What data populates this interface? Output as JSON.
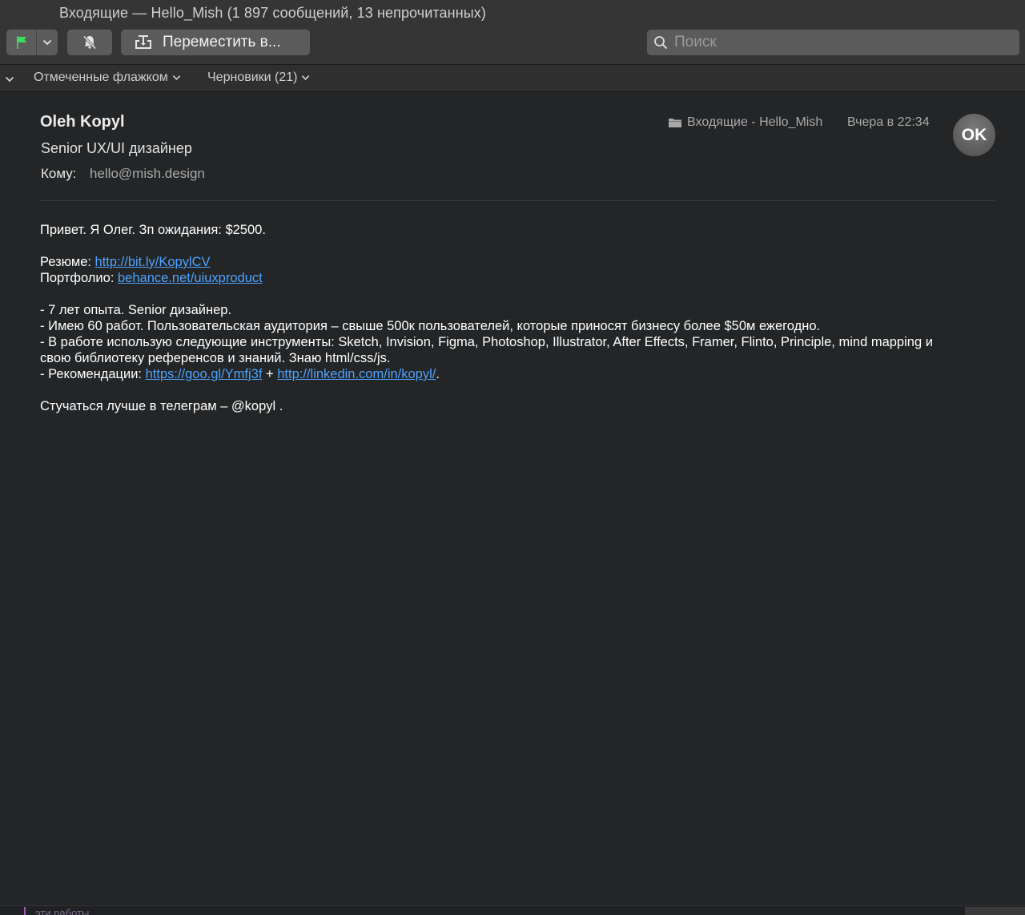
{
  "window": {
    "title": "Входящие — Hello_Mish (1 897 сообщений, 13 непрочитанных)"
  },
  "toolbar": {
    "move_label": "Переместить в...",
    "search_placeholder": "Поиск"
  },
  "favorites": {
    "flagged_label": "Отмеченные флажком",
    "drafts_label": "Черновики (21)"
  },
  "message": {
    "sender_name": "Oleh Kopyl",
    "sender_title": "Senior UX/UI дизайнер",
    "to_label": "Кому:",
    "to_value": "hello@mish.design",
    "mailbox": "Входящие - Hello_Mish",
    "date": "Вчера в 22:34",
    "avatar_initials": "OK",
    "body": {
      "greeting": "Привет. Я Олег. Зп ожидания: $2500.",
      "resume_label": "Резюме: ",
      "resume_link": "http://bit.ly/KopylCV",
      "portfolio_label": "Портфолио: ",
      "portfolio_link": "behance.net/uiuxproduct",
      "line_experience": "- 7 лет опыта. Senior дизайнер.",
      "line_works": "- Имею 60 работ. Пользовательская аудитория – свыше 500к пользователей, которые приносят бизнесу более $50м ежегодно.",
      "line_tools_1": "- В работе использую следующие инструменты: Sketch, Invision, Figma, Photoshop, Illustrator, After Effects, Framer, Flinto, Principle, mind mapping и",
      "line_tools_2": "свою библиотеку референсов и знаний. Знаю html/css/js.",
      "recommend_label": "- Рекомендации: ",
      "recommend_link_1": "https://goo.gl/Ymfj3f",
      "recommend_plus": " + ",
      "recommend_link_2": "http://linkedin.com/in/kopyl/",
      "recommend_end": ".",
      "contact": "Стучаться лучше в телеграм – @kopyl ."
    }
  },
  "bottom": {
    "partial_text": "эти работы"
  },
  "colors": {
    "background": "#232527",
    "toolbar": "#353535",
    "button": "#5b5b5b",
    "link": "#4fa3ff",
    "flag": "#3ddc5a"
  },
  "icons": [
    "flag-icon",
    "chevron-down-icon",
    "bell-slash-icon",
    "move-tray-icon",
    "search-icon",
    "folder-icon"
  ]
}
